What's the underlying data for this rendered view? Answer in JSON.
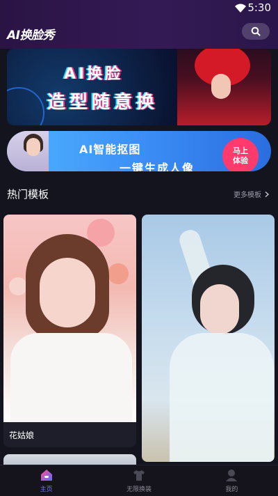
{
  "status_bar": {
    "time": "5:30"
  },
  "header": {
    "logo": "AI换脸秀"
  },
  "banner1": {
    "line1": "AI换脸",
    "line2": "造型随意换"
  },
  "banner2": {
    "title": "AI智能抠图",
    "subtitle": "一键生成人像",
    "cta_line1": "马上",
    "cta_line2": "体验"
  },
  "section": {
    "title": "热门模板",
    "more_label": "更多模板"
  },
  "templates": [
    {
      "label": "花姑娘"
    },
    {
      "label": ""
    }
  ],
  "tabs": [
    {
      "label": "主页",
      "icon": "home-icon"
    },
    {
      "label": "无限换装",
      "icon": "shirt-icon"
    },
    {
      "label": "我的",
      "icon": "profile-icon"
    }
  ],
  "colors": {
    "accent": "#6f7cff",
    "cta": "#ff3b6e"
  }
}
